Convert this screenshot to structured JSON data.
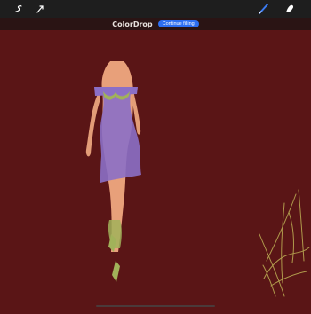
{
  "toolbar": {
    "left_tools": [
      {
        "icon": "modify-icon"
      },
      {
        "icon": "selection-arrow-icon"
      }
    ],
    "right_tools": [
      {
        "icon": "brush-icon",
        "active_color": "#3b7bf2"
      },
      {
        "icon": "smudge-icon"
      }
    ]
  },
  "colordrop": {
    "title": "ColorDrop",
    "continue_label": "Continue filling"
  },
  "canvas": {
    "background_color": "#5b1617",
    "content": "fashion-figure-drawing"
  }
}
